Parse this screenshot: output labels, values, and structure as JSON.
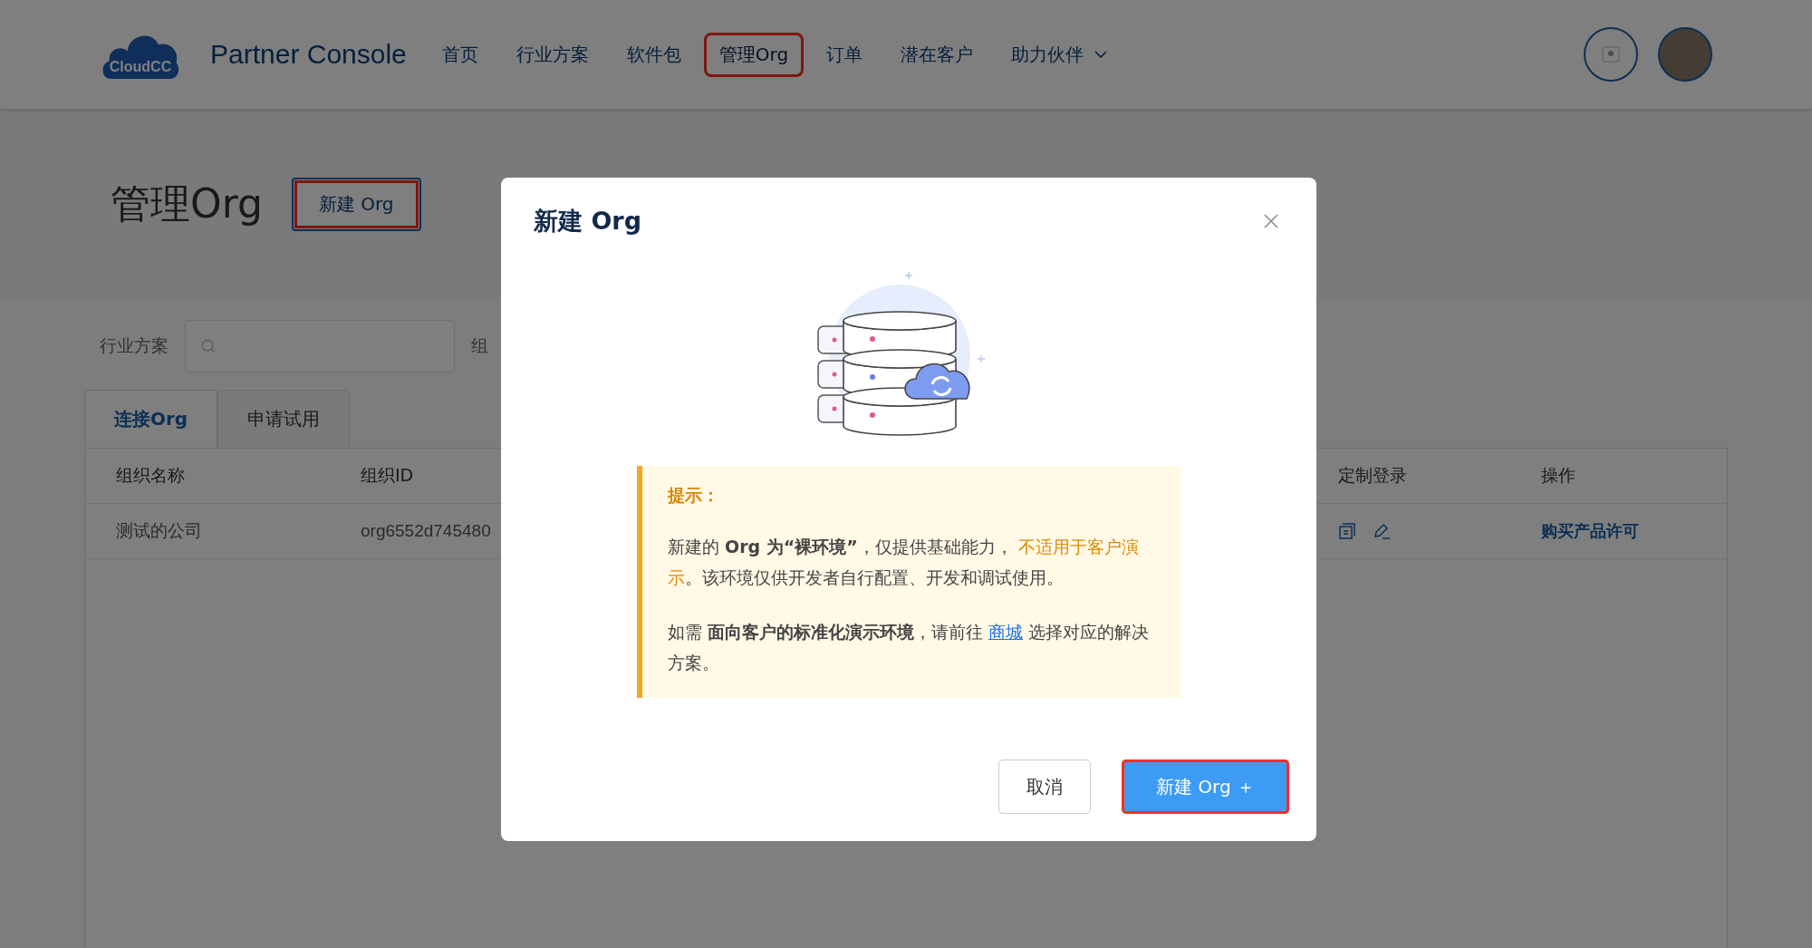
{
  "header": {
    "logo_text": "CloudCC",
    "app_title": "Partner Console",
    "nav": [
      {
        "label": "首页",
        "selected": false,
        "highlighted": false,
        "dropdown": false
      },
      {
        "label": "行业方案",
        "selected": false,
        "highlighted": false,
        "dropdown": false
      },
      {
        "label": "软件包",
        "selected": false,
        "highlighted": false,
        "dropdown": false
      },
      {
        "label": "管理Org",
        "selected": true,
        "highlighted": true,
        "dropdown": false
      },
      {
        "label": "订单",
        "selected": false,
        "highlighted": false,
        "dropdown": false
      },
      {
        "label": "潜在客户",
        "selected": false,
        "highlighted": false,
        "dropdown": false
      },
      {
        "label": "助力伙伴",
        "selected": false,
        "highlighted": false,
        "dropdown": true
      }
    ]
  },
  "page": {
    "title": "管理Org",
    "new_button": {
      "label": "新建 Org",
      "highlighted": true
    }
  },
  "filters": [
    {
      "label": "行业方案",
      "kind": "search"
    },
    {
      "label": "组",
      "kind": "label"
    }
  ],
  "tabs": [
    {
      "label": "连接Org",
      "selected": true
    },
    {
      "label": "申请试用",
      "selected": false
    }
  ],
  "table": {
    "columns": [
      "组织名称",
      "组织ID",
      "定制登录",
      "操作"
    ],
    "rows": [
      {
        "name": "测试的公司",
        "org_id": "org6552d745480",
        "action": "购买产品许可"
      }
    ]
  },
  "modal": {
    "title": "新建 Org",
    "tip": {
      "heading": "提示：",
      "paragraphs": [
        [
          {
            "kind": "plain",
            "text": "新建的 "
          },
          {
            "kind": "strong",
            "text": "Org 为“裸环境”"
          },
          {
            "kind": "plain",
            "text": "，仅提供基础能力， "
          },
          {
            "kind": "warning",
            "text": "不适用于客户演示"
          },
          {
            "kind": "plain",
            "text": "。该环境仅供开发者自行配置、开发和调试使用。"
          }
        ],
        [
          {
            "kind": "plain",
            "text": "如需 "
          },
          {
            "kind": "strong",
            "text": "面向客户的标准化演示环境"
          },
          {
            "kind": "plain",
            "text": "，请前往 "
          },
          {
            "kind": "link",
            "text": "商城"
          },
          {
            "kind": "plain",
            "text": " 选择对应的解决方案。"
          }
        ]
      ]
    },
    "buttons": [
      {
        "label": "取消",
        "kind": "secondary",
        "highlighted": false
      },
      {
        "label": "新建 Org ＋",
        "kind": "primary",
        "highlighted": true
      }
    ]
  }
}
